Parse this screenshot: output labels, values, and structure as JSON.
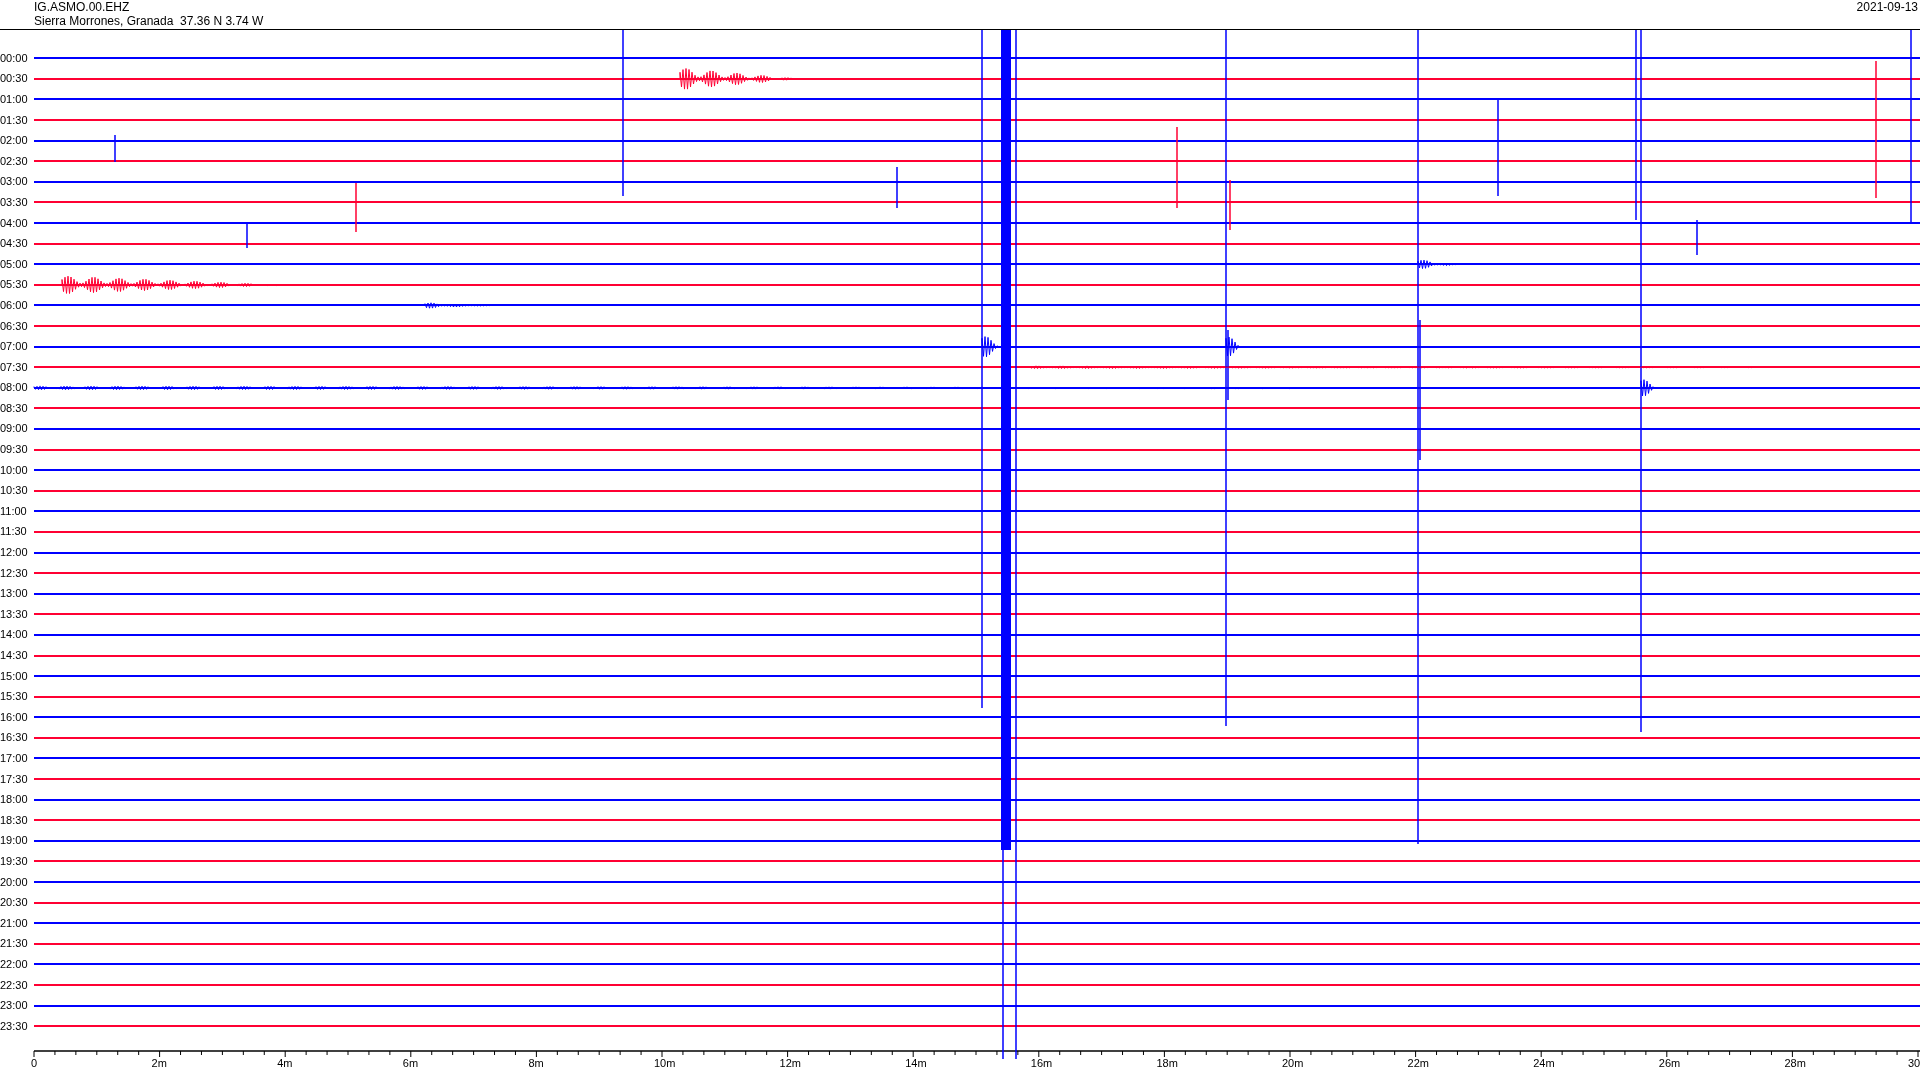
{
  "header": {
    "station": "IG.ASMO.00.EHZ",
    "location": "Sierra Morrones, Granada  37.36 N 3.74 W",
    "date": "2021-09-13"
  },
  "rows": [
    {
      "label": "00:00",
      "color": "#0000ff"
    },
    {
      "label": "00:30",
      "color": "#ff0033"
    },
    {
      "label": "01:00",
      "color": "#0000ff"
    },
    {
      "label": "01:30",
      "color": "#ff0033"
    },
    {
      "label": "02:00",
      "color": "#0000ff"
    },
    {
      "label": "02:30",
      "color": "#ff0033"
    },
    {
      "label": "03:00",
      "color": "#0000ff"
    },
    {
      "label": "03:30",
      "color": "#ff0033"
    },
    {
      "label": "04:00",
      "color": "#0000ff"
    },
    {
      "label": "04:30",
      "color": "#ff0033"
    },
    {
      "label": "05:00",
      "color": "#0000ff"
    },
    {
      "label": "05:30",
      "color": "#ff0033"
    },
    {
      "label": "06:00",
      "color": "#0000ff"
    },
    {
      "label": "06:30",
      "color": "#ff0033"
    },
    {
      "label": "07:00",
      "color": "#0000ff"
    },
    {
      "label": "07:30",
      "color": "#ff0033"
    },
    {
      "label": "08:00",
      "color": "#0000ff"
    },
    {
      "label": "08:30",
      "color": "#ff0033"
    },
    {
      "label": "09:00",
      "color": "#0000ff"
    },
    {
      "label": "09:30",
      "color": "#ff0033"
    },
    {
      "label": "10:00",
      "color": "#0000ff"
    },
    {
      "label": "10:30",
      "color": "#ff0033"
    },
    {
      "label": "11:00",
      "color": "#0000ff"
    },
    {
      "label": "11:30",
      "color": "#ff0033"
    },
    {
      "label": "12:00",
      "color": "#0000ff"
    },
    {
      "label": "12:30",
      "color": "#ff0033"
    },
    {
      "label": "13:00",
      "color": "#0000ff"
    },
    {
      "label": "13:30",
      "color": "#ff0033"
    },
    {
      "label": "14:00",
      "color": "#0000ff"
    },
    {
      "label": "14:30",
      "color": "#ff0033"
    },
    {
      "label": "15:00",
      "color": "#0000ff"
    },
    {
      "label": "15:30",
      "color": "#ff0033"
    },
    {
      "label": "16:00",
      "color": "#0000ff"
    },
    {
      "label": "16:30",
      "color": "#ff0033"
    },
    {
      "label": "17:00",
      "color": "#0000ff"
    },
    {
      "label": "17:30",
      "color": "#ff0033"
    },
    {
      "label": "18:00",
      "color": "#0000ff"
    },
    {
      "label": "18:30",
      "color": "#ff0033"
    },
    {
      "label": "19:00",
      "color": "#0000ff"
    },
    {
      "label": "19:30",
      "color": "#ff0033"
    },
    {
      "label": "20:00",
      "color": "#0000ff"
    },
    {
      "label": "20:30",
      "color": "#ff0033"
    },
    {
      "label": "21:00",
      "color": "#0000ff"
    },
    {
      "label": "21:30",
      "color": "#ff0033"
    },
    {
      "label": "22:00",
      "color": "#0000ff"
    },
    {
      "label": "22:30",
      "color": "#ff0033"
    },
    {
      "label": "23:00",
      "color": "#0000ff"
    },
    {
      "label": "23:30",
      "color": "#ff0033"
    }
  ],
  "x_axis": {
    "labels": [
      "0",
      "2m",
      "4m",
      "6m",
      "8m",
      "10m",
      "12m",
      "14m",
      "16m",
      "18m",
      "20m",
      "22m",
      "24m",
      "26m",
      "28m",
      "30"
    ]
  }
}
